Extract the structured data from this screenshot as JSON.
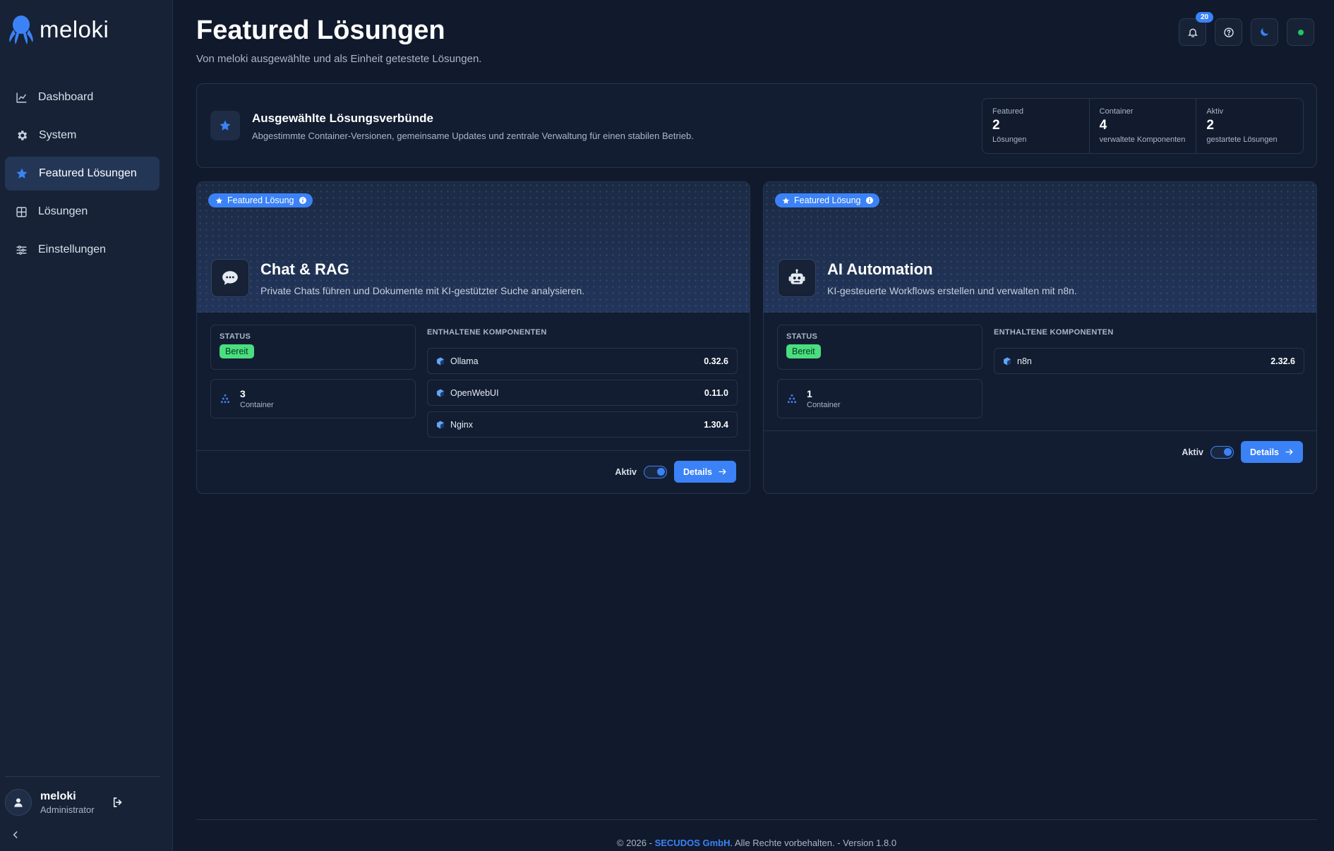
{
  "app": {
    "logo_text": "meloki"
  },
  "sidebar": {
    "items": [
      {
        "label": "Dashboard",
        "icon": "chart-line-icon"
      },
      {
        "label": "System",
        "icon": "gear-icon"
      },
      {
        "label": "Featured Lösungen",
        "icon": "star-icon",
        "active": true
      },
      {
        "label": "Lösungen",
        "icon": "grid-icon"
      },
      {
        "label": "Einstellungen",
        "icon": "sliders-icon"
      }
    ],
    "user": {
      "name": "meloki",
      "role": "Administrator"
    }
  },
  "header": {
    "title": "Featured Lösungen",
    "subtitle": "Von meloki ausgewählte und als Einheit getestete Lösungen.",
    "notifications_count": "20"
  },
  "banner": {
    "title": "Ausgewählte Lösungsverbünde",
    "description": "Abgestimmte Container-Versionen, gemeinsame Updates und zentrale Verwaltung für einen stabilen Betrieb.",
    "stats": [
      {
        "label": "Featured",
        "value": "2",
        "sub": "Lösungen"
      },
      {
        "label": "Container",
        "value": "4",
        "sub": "verwaltete Komponenten"
      },
      {
        "label": "Aktiv",
        "value": "2",
        "sub": "gestartete Lösungen"
      }
    ]
  },
  "cards": [
    {
      "tag": "Featured Lösung",
      "title": "Chat & RAG",
      "description": "Private Chats führen und Dokumente mit KI-gestützter Suche analysieren.",
      "icon": "chat-bubble-icon",
      "status_label": "STATUS",
      "status": "Bereit",
      "container_count": "3",
      "container_label": "Container",
      "components_label": "ENTHALTENE KOMPONENTEN",
      "components": [
        {
          "name": "Ollama",
          "version": "0.32.6"
        },
        {
          "name": "OpenWebUI",
          "version": "0.11.0"
        },
        {
          "name": "Nginx",
          "version": "1.30.4"
        }
      ],
      "aktiv_label": "Aktiv",
      "active": true,
      "details_label": "Details"
    },
    {
      "tag": "Featured Lösung",
      "title": "AI Automation",
      "description": "KI-gesteuerte Workflows erstellen und verwalten mit n8n.",
      "icon": "robot-icon",
      "status_label": "STATUS",
      "status": "Bereit",
      "container_count": "1",
      "container_label": "Container",
      "components_label": "ENTHALTENE KOMPONENTEN",
      "components": [
        {
          "name": "n8n",
          "version": "2.32.6"
        }
      ],
      "aktiv_label": "Aktiv",
      "active": true,
      "details_label": "Details"
    }
  ],
  "footer": {
    "prefix": "© 2026 - ",
    "company": "SECUDOS GmbH",
    "suffix": ". Alle Rechte vorbehalten. - Version 1.8.0"
  },
  "colors": {
    "background": "#101a2c",
    "sidebar": "#172236",
    "accent": "#3b82f6",
    "ready": "#4ade80",
    "online": "#22c55e"
  }
}
